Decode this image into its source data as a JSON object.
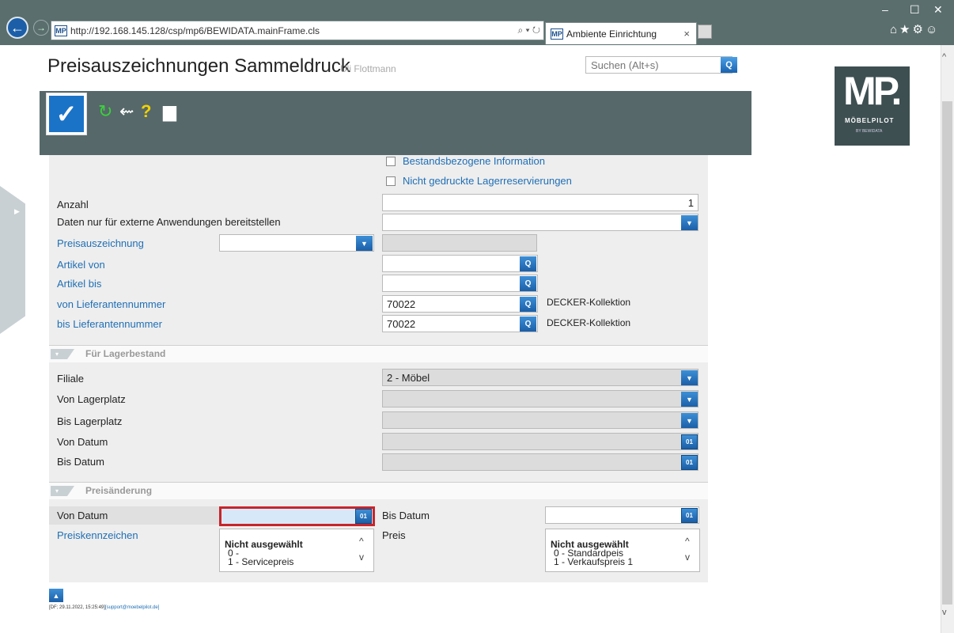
{
  "browser": {
    "url": "http://192.168.145.128/csp/mp6/BEWIDATA.mainFrame.cls",
    "url_controls": "⌕ ▾ ↻",
    "tab_title": "Ambiente Einrichtung",
    "favicon_text": "MP"
  },
  "app": {
    "title": "Preisauszeichnungen Sammeldruck",
    "user": "Uli Flottmann",
    "search_placeholder": "Suchen (Alt+s)",
    "logo_text": "MP.",
    "logo_sub": "MÖBELPILOT",
    "logo_small": "BY BEWIDATA"
  },
  "form": {
    "checkbox_stock": "Bestandsbezogene Information",
    "checkbox_reservations": "Nicht gedruckte Lagerreservierungen",
    "anzahl_label": "Anzahl",
    "anzahl_value": "1",
    "daten_label": "Daten nur für externe Anwendungen bereitstellen",
    "preisauszeichnung_label": "Preisauszeichnung",
    "artikel_von_label": "Artikel von",
    "artikel_bis_label": "Artikel bis",
    "von_lief_label": "von Lieferantennummer",
    "von_lief_value": "70022",
    "von_lief_name": "DECKER-Kollektion",
    "bis_lief_label": "bis Lieferantennummer",
    "bis_lief_value": "70022",
    "bis_lief_name": "DECKER-Kollektion"
  },
  "lager": {
    "section_title": "Für Lagerbestand",
    "filiale_label": "Filiale",
    "filiale_value": "2 - Möbel",
    "von_lagerplatz_label": "Von Lagerplatz",
    "bis_lagerplatz_label": "Bis Lagerplatz",
    "von_datum_label": "Von Datum",
    "bis_datum_label": "Bis Datum"
  },
  "preis": {
    "section_title": "Preisänderung",
    "von_datum_label": "Von Datum",
    "bis_datum_label": "Bis Datum",
    "preiskennzeichen_label": "Preiskennzeichen",
    "preis_label": "Preis",
    "kennzeichen_options": [
      "Nicht ausgewählt",
      "0 -",
      "1 - Servicepreis"
    ],
    "preis_options": [
      "Nicht ausgewählt",
      "0 - Standardpeis",
      "1 - Verkaufspreis 1"
    ]
  },
  "footer": {
    "text": "[DF; 29.11.2022, 15:25:49]",
    "email": "[support@moebelpilot.de]"
  },
  "icons": {
    "calendar": "01",
    "dropdown": "▼",
    "lookup": "Q"
  }
}
